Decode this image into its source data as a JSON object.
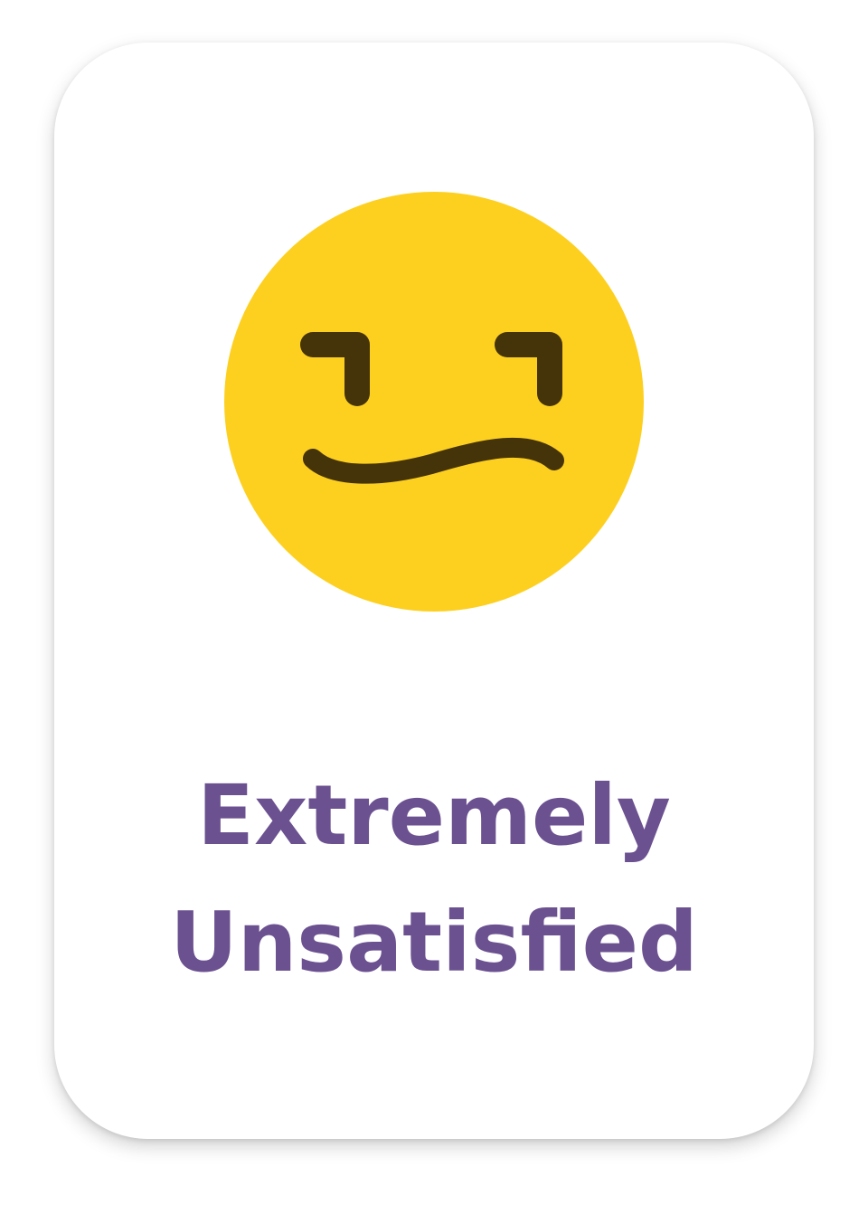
{
  "card": {
    "icon": "unsatisfied-face-icon",
    "label_line1": "Extremely",
    "label_line2": "Unsatisfied",
    "colors": {
      "face": "#fdd020",
      "features": "#45330a",
      "label": "#6b5190",
      "background": "#ffffff"
    }
  }
}
